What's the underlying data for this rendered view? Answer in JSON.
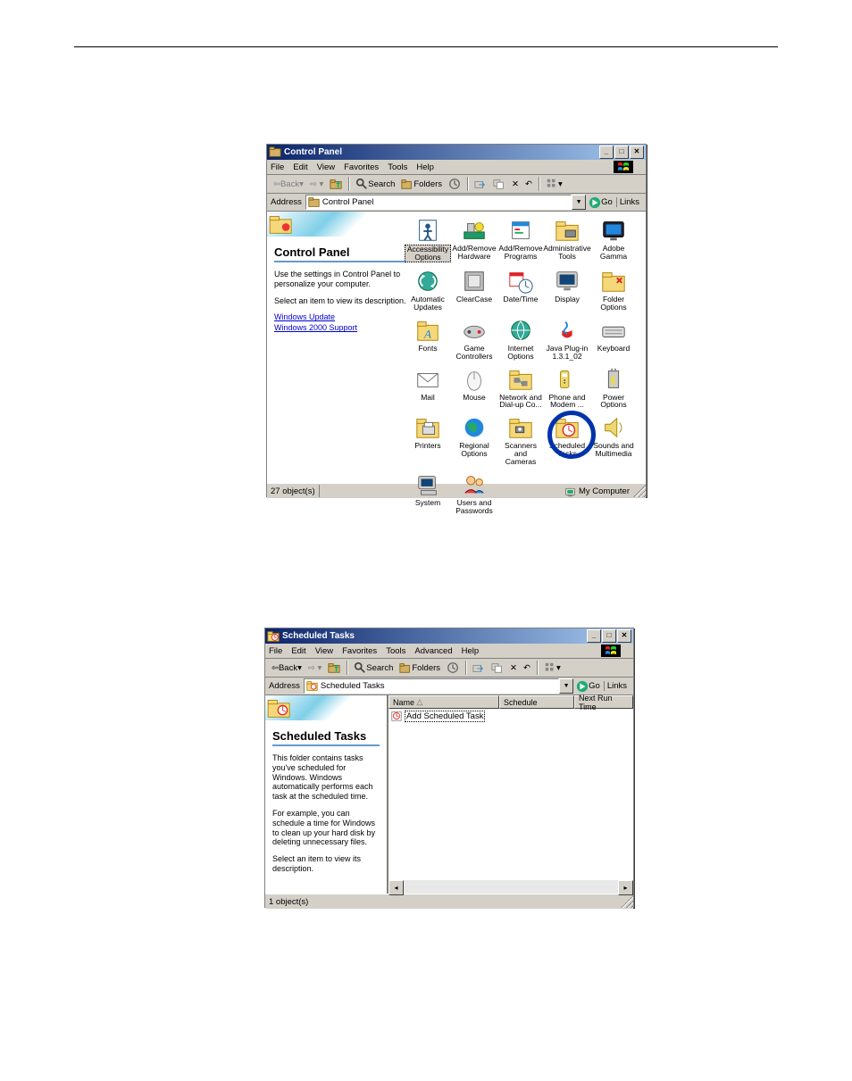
{
  "cp_window": {
    "title": "Control Panel",
    "menus": [
      "File",
      "Edit",
      "View",
      "Favorites",
      "Tools",
      "Help"
    ],
    "toolbar": {
      "back": "Back",
      "search": "Search",
      "folders": "Folders"
    },
    "address_label": "Address",
    "address_value": "Control Panel",
    "go_label": "Go",
    "links_label": "Links",
    "sidebar": {
      "heading": "Control Panel",
      "desc1": "Use the settings in Control Panel to personalize your computer.",
      "desc2": "Select an item to view its description.",
      "links": [
        "Windows Update",
        "Windows 2000 Support"
      ]
    },
    "items": [
      {
        "label": "Accessibility Options",
        "selected": true
      },
      {
        "label": "Add/Remove Hardware"
      },
      {
        "label": "Add/Remove Programs"
      },
      {
        "label": "Administrative Tools"
      },
      {
        "label": "Adobe Gamma"
      },
      {
        "label": "Automatic Updates"
      },
      {
        "label": "ClearCase"
      },
      {
        "label": "Date/Time"
      },
      {
        "label": "Display"
      },
      {
        "label": "Folder Options"
      },
      {
        "label": "Fonts"
      },
      {
        "label": "Game Controllers"
      },
      {
        "label": "Internet Options"
      },
      {
        "label": "Java Plug-in 1.3.1_02"
      },
      {
        "label": "Keyboard"
      },
      {
        "label": "Mail"
      },
      {
        "label": "Mouse"
      },
      {
        "label": "Network and Dial-up Co..."
      },
      {
        "label": "Phone and Modem ..."
      },
      {
        "label": "Power Options"
      },
      {
        "label": "Printers"
      },
      {
        "label": "Regional Options"
      },
      {
        "label": "Scanners and Cameras"
      },
      {
        "label": "Scheduled Tasks",
        "circled": true
      },
      {
        "label": "Sounds and Multimedia"
      },
      {
        "label": "System"
      },
      {
        "label": "Users and Passwords"
      }
    ],
    "status_left": "27 object(s)",
    "status_right": "My Computer"
  },
  "st_window": {
    "title": "Scheduled Tasks",
    "menus": [
      "File",
      "Edit",
      "View",
      "Favorites",
      "Tools",
      "Advanced",
      "Help"
    ],
    "toolbar": {
      "back": "Back",
      "search": "Search",
      "folders": "Folders"
    },
    "address_label": "Address",
    "address_value": "Scheduled Tasks",
    "go_label": "Go",
    "links_label": "Links",
    "sidebar": {
      "heading": "Scheduled Tasks",
      "para1": "This folder contains tasks you've scheduled for Windows. Windows automatically performs each task at the scheduled time.",
      "para2": "For example, you can schedule a time for Windows to clean up your hard disk by deleting unnecessary files.",
      "para3": "Select an item to view its description."
    },
    "columns": [
      "Name",
      "Schedule",
      "Next Run Time"
    ],
    "rows": [
      {
        "label": "Add Scheduled Task",
        "selected": true
      }
    ],
    "status_left": "1 object(s)"
  }
}
